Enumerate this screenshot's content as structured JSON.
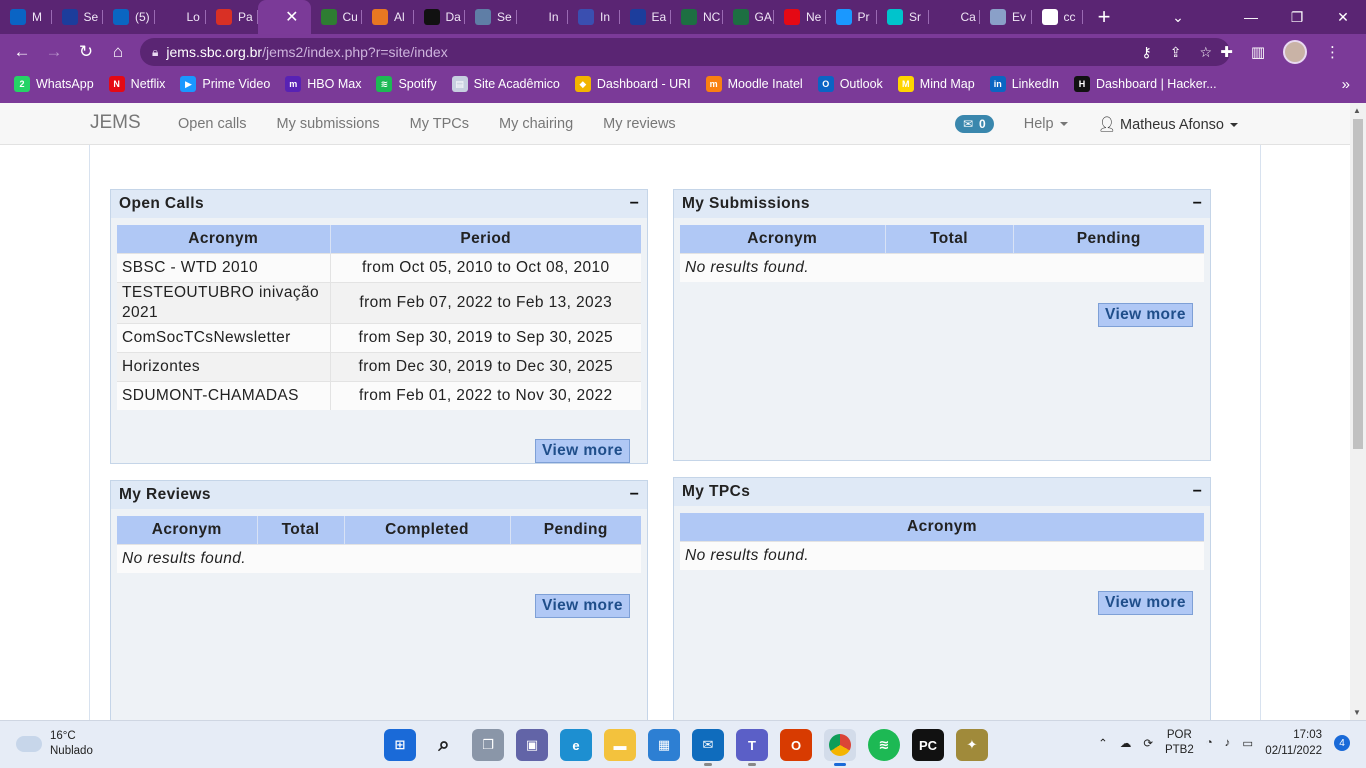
{
  "browser": {
    "tabs": [
      {
        "label": "M",
        "icon": "outlook-icon",
        "color": "#0a64c4"
      },
      {
        "label": "Se",
        "icon": "inatel-icon",
        "color": "#1c3d9c"
      },
      {
        "label": "(5)",
        "icon": "linkedin-icon",
        "color": "#0a66c2"
      },
      {
        "label": "Lo",
        "icon": "globe-icon",
        "color": "#5a2573"
      },
      {
        "label": "Pa",
        "icon": "gmail-icon",
        "color": "#d93025"
      },
      {
        "label": "",
        "icon": "active-tab",
        "color": "#7b3a98"
      },
      {
        "label": "Cu",
        "icon": "course-icon",
        "color": "#2e7d32"
      },
      {
        "label": "Al",
        "icon": "alura-icon",
        "color": "#e87722"
      },
      {
        "label": "Da",
        "icon": "hackerrank-icon",
        "color": "#111111"
      },
      {
        "label": "Se",
        "icon": "document-icon",
        "color": "#5f7ea6"
      },
      {
        "label": "In",
        "icon": "globe-icon",
        "color": "#5a2573"
      },
      {
        "label": "In",
        "icon": "inatel-circle-icon",
        "color": "#3a4fb0"
      },
      {
        "label": "Ea",
        "icon": "inatel-icon",
        "color": "#1c3d9c"
      },
      {
        "label": "NC",
        "icon": "excel-icon",
        "color": "#1d6f42"
      },
      {
        "label": "GA",
        "icon": "excel-icon",
        "color": "#1d6f42"
      },
      {
        "label": "Ne",
        "icon": "netflix-icon",
        "color": "#e50914"
      },
      {
        "label": "Pr",
        "icon": "prime-icon",
        "color": "#1a98ff"
      },
      {
        "label": "Sr",
        "icon": "canva-icon",
        "color": "#00c4cc"
      },
      {
        "label": "Ca",
        "icon": "globe-icon",
        "color": "#5a2573"
      },
      {
        "label": "Ev",
        "icon": "event-icon",
        "color": "#8aa0c8"
      },
      {
        "label": "cc",
        "icon": "google-icon",
        "color": "#ffffff"
      }
    ],
    "active_tab_close": "✕",
    "new_tab": "+",
    "url_host": "jems.sbc.org.br",
    "url_rest": "/jems2/index.php?r=site/index",
    "bookmarks": [
      {
        "label": "WhatsApp",
        "icon": "whatsapp-icon",
        "color": "#25d366",
        "glyph": "2"
      },
      {
        "label": "Netflix",
        "icon": "netflix-icon",
        "color": "#e50914",
        "glyph": "N"
      },
      {
        "label": "Prime Video",
        "icon": "prime-video-icon",
        "color": "#1a98ff",
        "glyph": "▶"
      },
      {
        "label": "HBO Max",
        "icon": "hbo-max-icon",
        "color": "#5822b4",
        "glyph": "m"
      },
      {
        "label": "Spotify",
        "icon": "spotify-icon",
        "color": "#1db954",
        "glyph": "≋"
      },
      {
        "label": "Site Acadêmico",
        "icon": "document-icon",
        "color": "#c7cfe0",
        "glyph": "▤"
      },
      {
        "label": "Dashboard - URI",
        "icon": "uri-icon",
        "color": "#f2b400",
        "glyph": "◆"
      },
      {
        "label": "Moodle Inatel",
        "icon": "moodle-icon",
        "color": "#f98012",
        "glyph": "m"
      },
      {
        "label": "Outlook",
        "icon": "outlook-icon",
        "color": "#0a64c4",
        "glyph": "O"
      },
      {
        "label": "Mind Map",
        "icon": "mindmap-icon",
        "color": "#ffd400",
        "glyph": "M"
      },
      {
        "label": "LinkedIn",
        "icon": "linkedin-icon",
        "color": "#0a66c2",
        "glyph": "in"
      },
      {
        "label": "Dashboard | Hacker...",
        "icon": "hackerrank-icon",
        "color": "#111111",
        "glyph": "H"
      }
    ]
  },
  "jems": {
    "brand": "JEMS",
    "nav": [
      "Open calls",
      "My submissions",
      "My TPCs",
      "My chairing",
      "My reviews"
    ],
    "messages_count": "0",
    "help_label": "Help",
    "user_name": "Matheus Afonso"
  },
  "portlets": {
    "open_calls": {
      "title": "Open Calls",
      "collapse": "−",
      "headers": [
        "Acronym",
        "Period"
      ],
      "rows": [
        {
          "acronym": "SBSC - WTD 2010",
          "period": "from Oct 05, 2010 to Oct 08, 2010"
        },
        {
          "acronym": "TESTEOUTUBRO inivação 2021",
          "period": "from Feb 07, 2022 to Feb 13, 2023"
        },
        {
          "acronym": "ComSocTCsNewsletter",
          "period": "from Sep 30, 2019 to Sep 30, 2025"
        },
        {
          "acronym": "Horizontes",
          "period": "from Dec 30, 2019 to Dec 30, 2025"
        },
        {
          "acronym": "SDUMONT-CHAMADAS",
          "period": "from Feb 01, 2022 to Nov 30, 2022"
        }
      ],
      "view_more": "View more"
    },
    "my_submissions": {
      "title": "My Submissions",
      "collapse": "−",
      "headers": [
        "Acronym",
        "Total",
        "Pending"
      ],
      "empty": "No results found.",
      "view_more": "View more"
    },
    "my_reviews": {
      "title": "My Reviews",
      "collapse": "−",
      "headers": [
        "Acronym",
        "Total",
        "Completed",
        "Pending"
      ],
      "empty": "No results found.",
      "view_more": "View more"
    },
    "my_tpcs": {
      "title": "My TPCs",
      "collapse": "−",
      "headers": [
        "Acronym"
      ],
      "empty": "No results found.",
      "view_more": "View more"
    }
  },
  "taskbar": {
    "weather_temp": "16°C",
    "weather_desc": "Nublado",
    "lang_top": "POR",
    "lang_bottom": "PTB2",
    "time": "17:03",
    "date": "02/11/2022",
    "notifications": "4"
  }
}
